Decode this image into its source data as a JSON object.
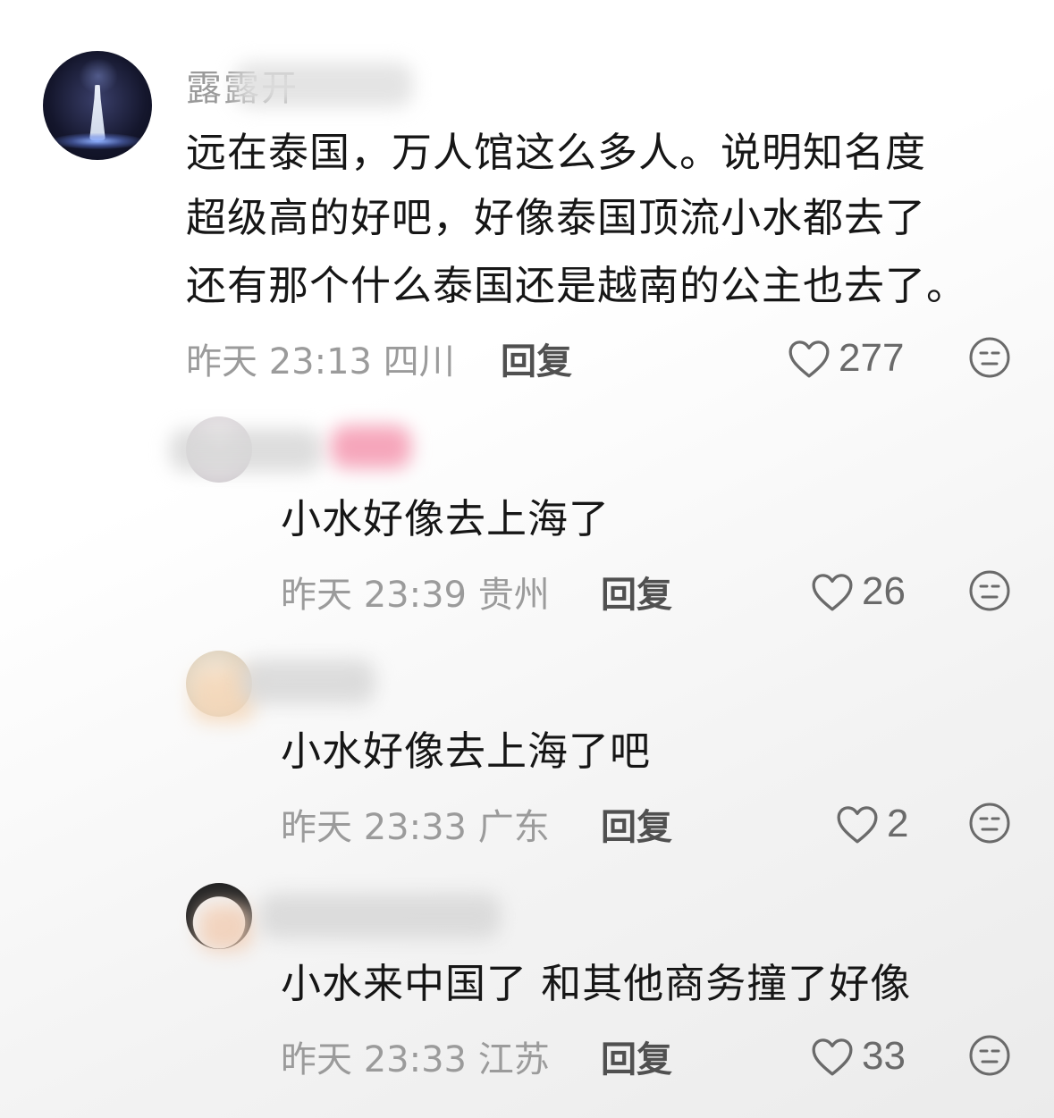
{
  "comments": [
    {
      "username": "露露开",
      "lines": [
        "远在泰国，万人馆这么多人。说明知名度",
        "超级高的好吧，好像泰国顶流小水都去了",
        "还有那个什么泰国还是越南的公主也去了。"
      ],
      "time": "昨天 23:13",
      "location": "四川",
      "reply_label": "回复",
      "likes": "277"
    },
    {
      "username": "",
      "lines": [
        "小水好像去上海了"
      ],
      "time": "昨天 23:39",
      "location": "贵州",
      "reply_label": "回复",
      "likes": "26"
    },
    {
      "username": "",
      "lines": [
        "小水好像去上海了吧"
      ],
      "time": "昨天 23:33",
      "location": "广东",
      "reply_label": "回复",
      "likes": "2"
    },
    {
      "username": "",
      "lines": [
        "小水来中国了 和其他商务撞了好像"
      ],
      "time": "昨天 23:33",
      "location": "江苏",
      "reply_label": "回复",
      "likes": "33"
    }
  ],
  "icons": {
    "like": "heart-outline-icon",
    "dislike": "dislike-face-icon"
  },
  "colors": {
    "primary_text": "#161616",
    "secondary_text": "#9b9b9b",
    "reply_text": "#505050",
    "icon": "#6a6a6a"
  }
}
